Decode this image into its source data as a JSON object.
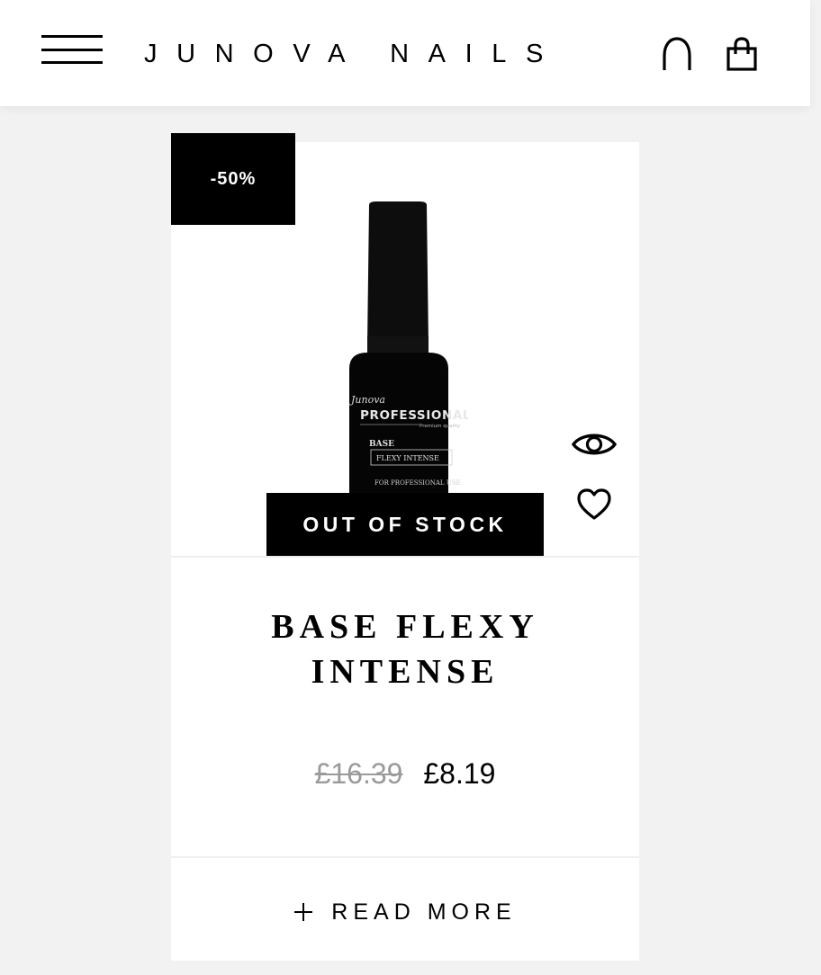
{
  "header": {
    "menu_icon": "hamburger-menu-icon",
    "logo": "JUNOVA NAILS",
    "account_icon": "user-account-icon",
    "cart_icon": "shopping-bag-icon"
  },
  "product": {
    "discount_badge": "-50%",
    "image_icon": "product-bottle-image",
    "bottle_text": {
      "brand_script": "Junova",
      "brand_line": "PROFESSIONAL",
      "tagline": "Premium quality",
      "type": "BASE",
      "variant": "FLEXY INTENSE",
      "footer": "FOR PROFESSIONAL USE"
    },
    "quick_view_icon": "eye-icon",
    "wishlist_icon": "heart-icon",
    "stock_status": "OUT OF STOCK",
    "title": "BASE FLEXY INTENSE",
    "price_old": "£16.39",
    "price_new": "£8.19",
    "read_more_icon": "plus-icon",
    "read_more_label": "READ MORE"
  },
  "colors": {
    "background": "#f2f2f2",
    "card": "#ffffff",
    "badge": "#000000",
    "old_price": "#9a9a9a"
  }
}
